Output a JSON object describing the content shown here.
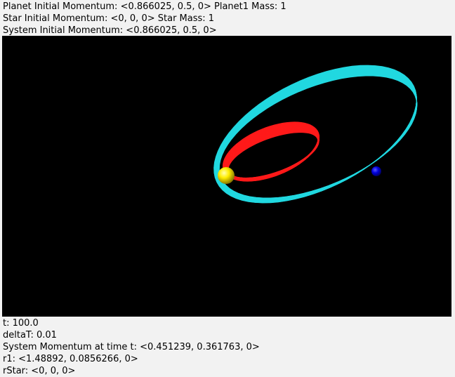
{
  "header": {
    "planet_initial_momentum": "Planet Initial Momentum: <0.866025, 0.5, 0>",
    "planet1_mass": "Planet1 Mass: 1",
    "star_initial_momentum": "Star Initial Momentum: <0, 0, 0>",
    "star_mass": "Star Mass: 1",
    "system_initial_momentum": "System Initial Momentum: <0.866025, 0.5, 0>"
  },
  "scene": {
    "background_color": "#000000",
    "star": {
      "color": "#ffee00",
      "shape": "sphere"
    },
    "planet": {
      "color": "#0000dd",
      "shape": "sphere"
    },
    "planet_trail_color": "#22d8e0",
    "star_trail_color": "#ff1a1a"
  },
  "footer": {
    "t": "t: 100.0",
    "deltaT": "deltaT: 0.01",
    "system_momentum": "System Momentum at time t: <0.451239, 0.361763, 0>",
    "r1": "r1: <1.48892, 0.0856266, 0>",
    "rStar": "rStar: <0, 0, 0>"
  }
}
